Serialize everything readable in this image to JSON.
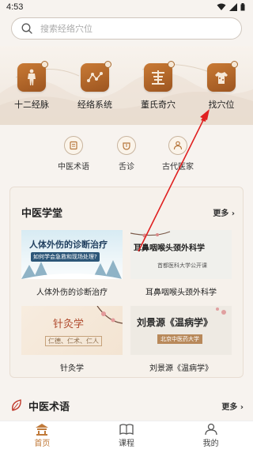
{
  "status_bar": {
    "time": "4:53"
  },
  "search": {
    "placeholder": "搜索经络穴位"
  },
  "categories": [
    {
      "label": "十二经脉",
      "icon": "human-body-icon"
    },
    {
      "label": "经络系统",
      "icon": "network-nodes-icon"
    },
    {
      "label": "董氏奇穴",
      "icon": "dong-character-icon"
    },
    {
      "label": "找穴位",
      "icon": "clothing-figure-icon"
    }
  ],
  "tools": [
    {
      "label": "中医术语",
      "icon": "book-icon"
    },
    {
      "label": "舌诊",
      "icon": "tongue-icon"
    },
    {
      "label": "古代医家",
      "icon": "doctor-icon"
    }
  ],
  "classroom": {
    "title": "中医学堂",
    "more": "更多",
    "courses": [
      {
        "title": "人体外伤的诊断治疗",
        "thumb_main": "人体外伤的诊断治疗",
        "thumb_sub": "如何学会急救和现场处理?"
      },
      {
        "title": "耳鼻咽喉头颈外科学",
        "thumb_main": "耳鼻咽喉头颈外科学",
        "thumb_sub": "首都医科大学公开课"
      },
      {
        "title": "针灸学",
        "thumb_main": "针灸学",
        "thumb_sub": "仁德、仁术、仁人"
      },
      {
        "title": "刘景源《温病学》",
        "thumb_main": "刘景源《温病学》",
        "thumb_sub": "北京中医药大学"
      }
    ]
  },
  "terms": {
    "title": "中医术语",
    "more": "更多"
  },
  "tabbar": {
    "items": [
      {
        "label": "首页",
        "active": true
      },
      {
        "label": "课程",
        "active": false
      },
      {
        "label": "我的",
        "active": false
      }
    ]
  },
  "colors": {
    "accent": "#c07a3a",
    "icon_brown": "#a9602a",
    "annotation_arrow": "#e02020"
  }
}
